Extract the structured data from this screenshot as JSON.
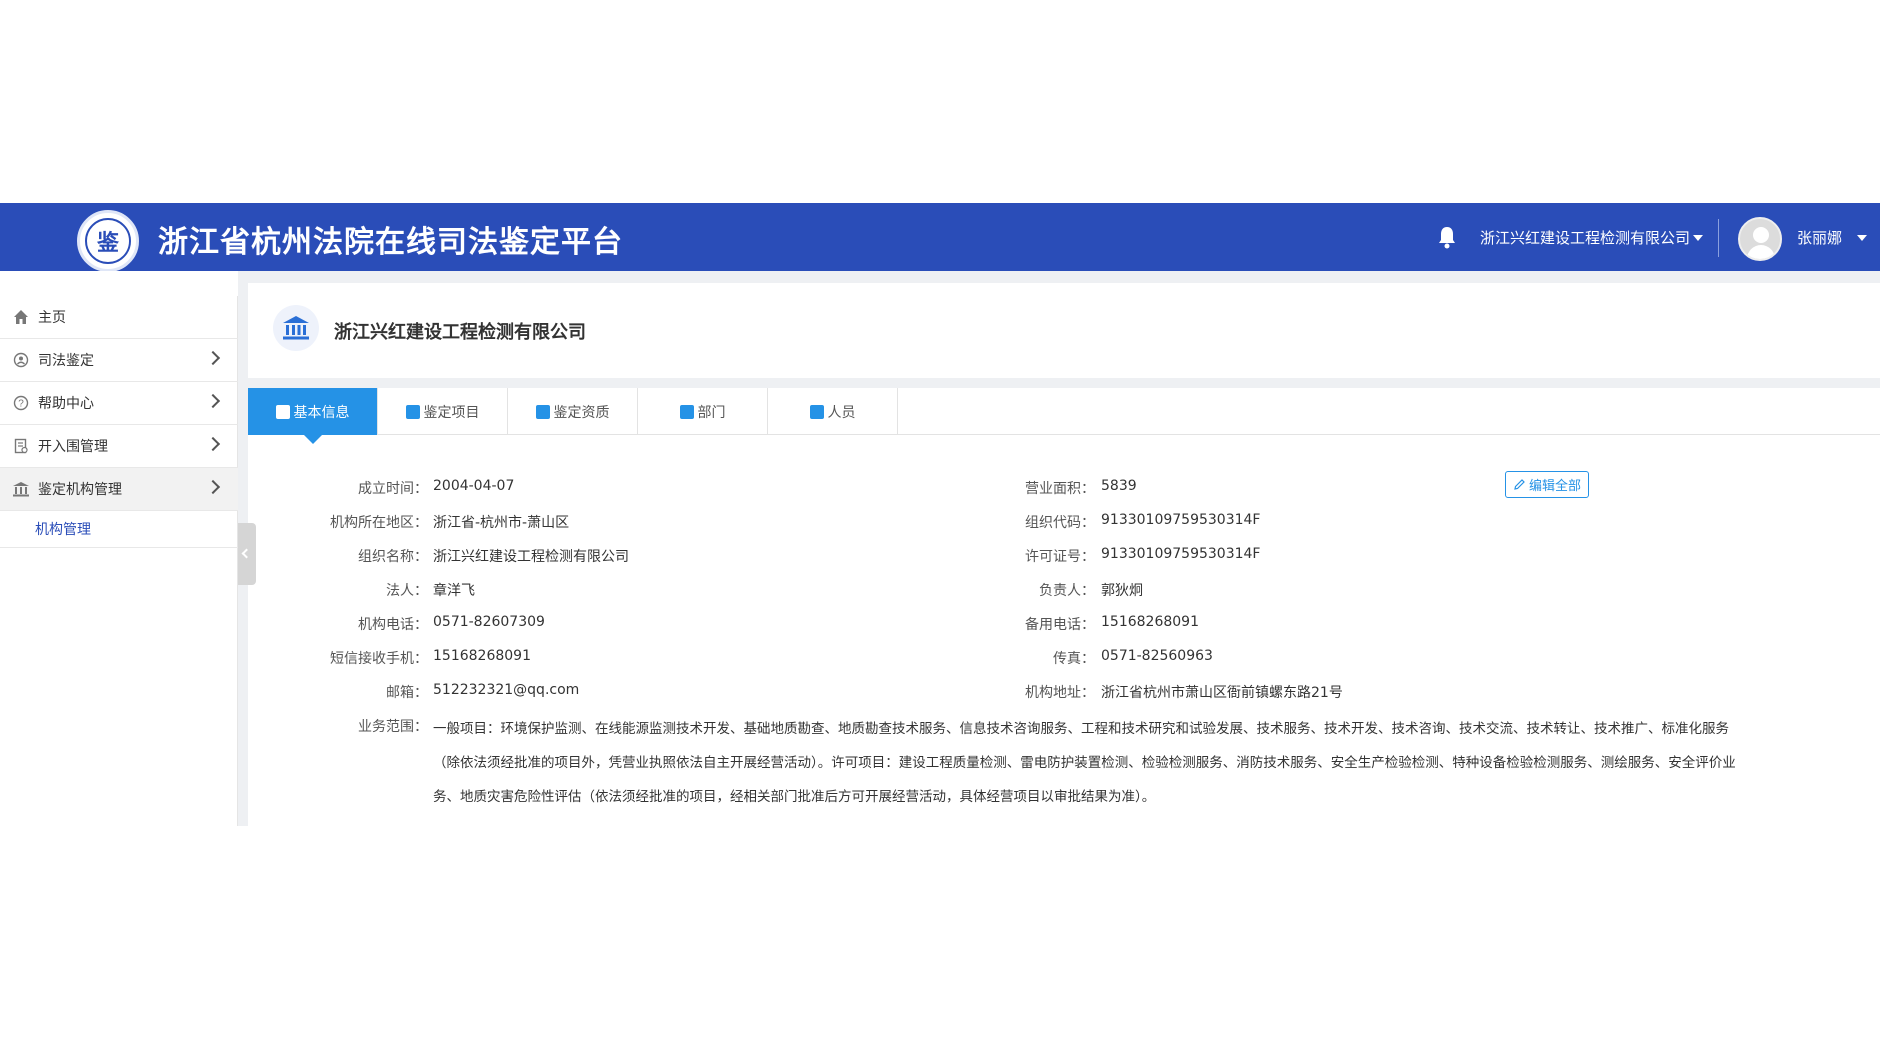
{
  "header": {
    "title": "浙江省杭州法院在线司法鉴定平台",
    "company_selector": "浙江兴红建设工程检测有限公司",
    "username": "张丽娜"
  },
  "sidebar": {
    "items": [
      {
        "label": "主页",
        "icon": "home-icon"
      },
      {
        "label": "司法鉴定",
        "icon": "seal-icon"
      },
      {
        "label": "帮助中心",
        "icon": "help-icon"
      },
      {
        "label": "开入围管理",
        "icon": "document-icon"
      },
      {
        "label": "鉴定机构管理",
        "icon": "institution-icon"
      }
    ],
    "sub_item": "机构管理"
  },
  "company": {
    "name": "浙江兴红建设工程检测有限公司"
  },
  "tabs": [
    {
      "label": "基本信息",
      "active": true
    },
    {
      "label": "鉴定项目",
      "active": false
    },
    {
      "label": "鉴定资质",
      "active": false
    },
    {
      "label": "部门",
      "active": false
    },
    {
      "label": "人员",
      "active": false
    }
  ],
  "edit_button": "编辑全部",
  "info": {
    "founded_label": "成立时间：",
    "founded": "2004-04-07",
    "area_label": "营业面积：",
    "area": "5839",
    "region_label": "机构所在地区：",
    "region": "浙江省-杭州市-萧山区",
    "org_code_label": "组织代码：",
    "org_code": "91330109759530314F",
    "org_name_label": "组织名称：",
    "org_name": "浙江兴红建设工程检测有限公司",
    "license_label": "许可证号：",
    "license": "91330109759530314F",
    "legal_label": "法人：",
    "legal": "章洋飞",
    "manager_label": "负责人：",
    "manager": "郭狄炯",
    "phone_label": "机构电话：",
    "phone": "0571-82607309",
    "backup_phone_label": "备用电话：",
    "backup_phone": "15168268091",
    "sms_label": "短信接收手机：",
    "sms": "15168268091",
    "fax_label": "传真：",
    "fax": "0571-82560963",
    "email_label": "邮箱：",
    "email": "512232321@qq.com",
    "address_label": "机构地址：",
    "address": "浙江省杭州市萧山区衙前镇螺东路21号",
    "business_label": "业务范围：",
    "business": "一般项目：环境保护监测、在线能源监测技术开发、基础地质勘查、地质勘查技术服务、信息技术咨询服务、工程和技术研究和试验发展、技术服务、技术开发、技术咨询、技术交流、技术转让、技术推广、标准化服务（除依法须经批准的项目外，凭营业执照依法自主开展经营活动）。许可项目：建设工程质量检测、雷电防护装置检测、检验检测服务、消防技术服务、安全生产检验检测、特种设备检验检测服务、测绘服务、安全评价业务、地质灾害危险性评估（依法须经批准的项目，经相关部门批准后方可开展经营活动，具体经营项目以审批结果为准）。"
  }
}
